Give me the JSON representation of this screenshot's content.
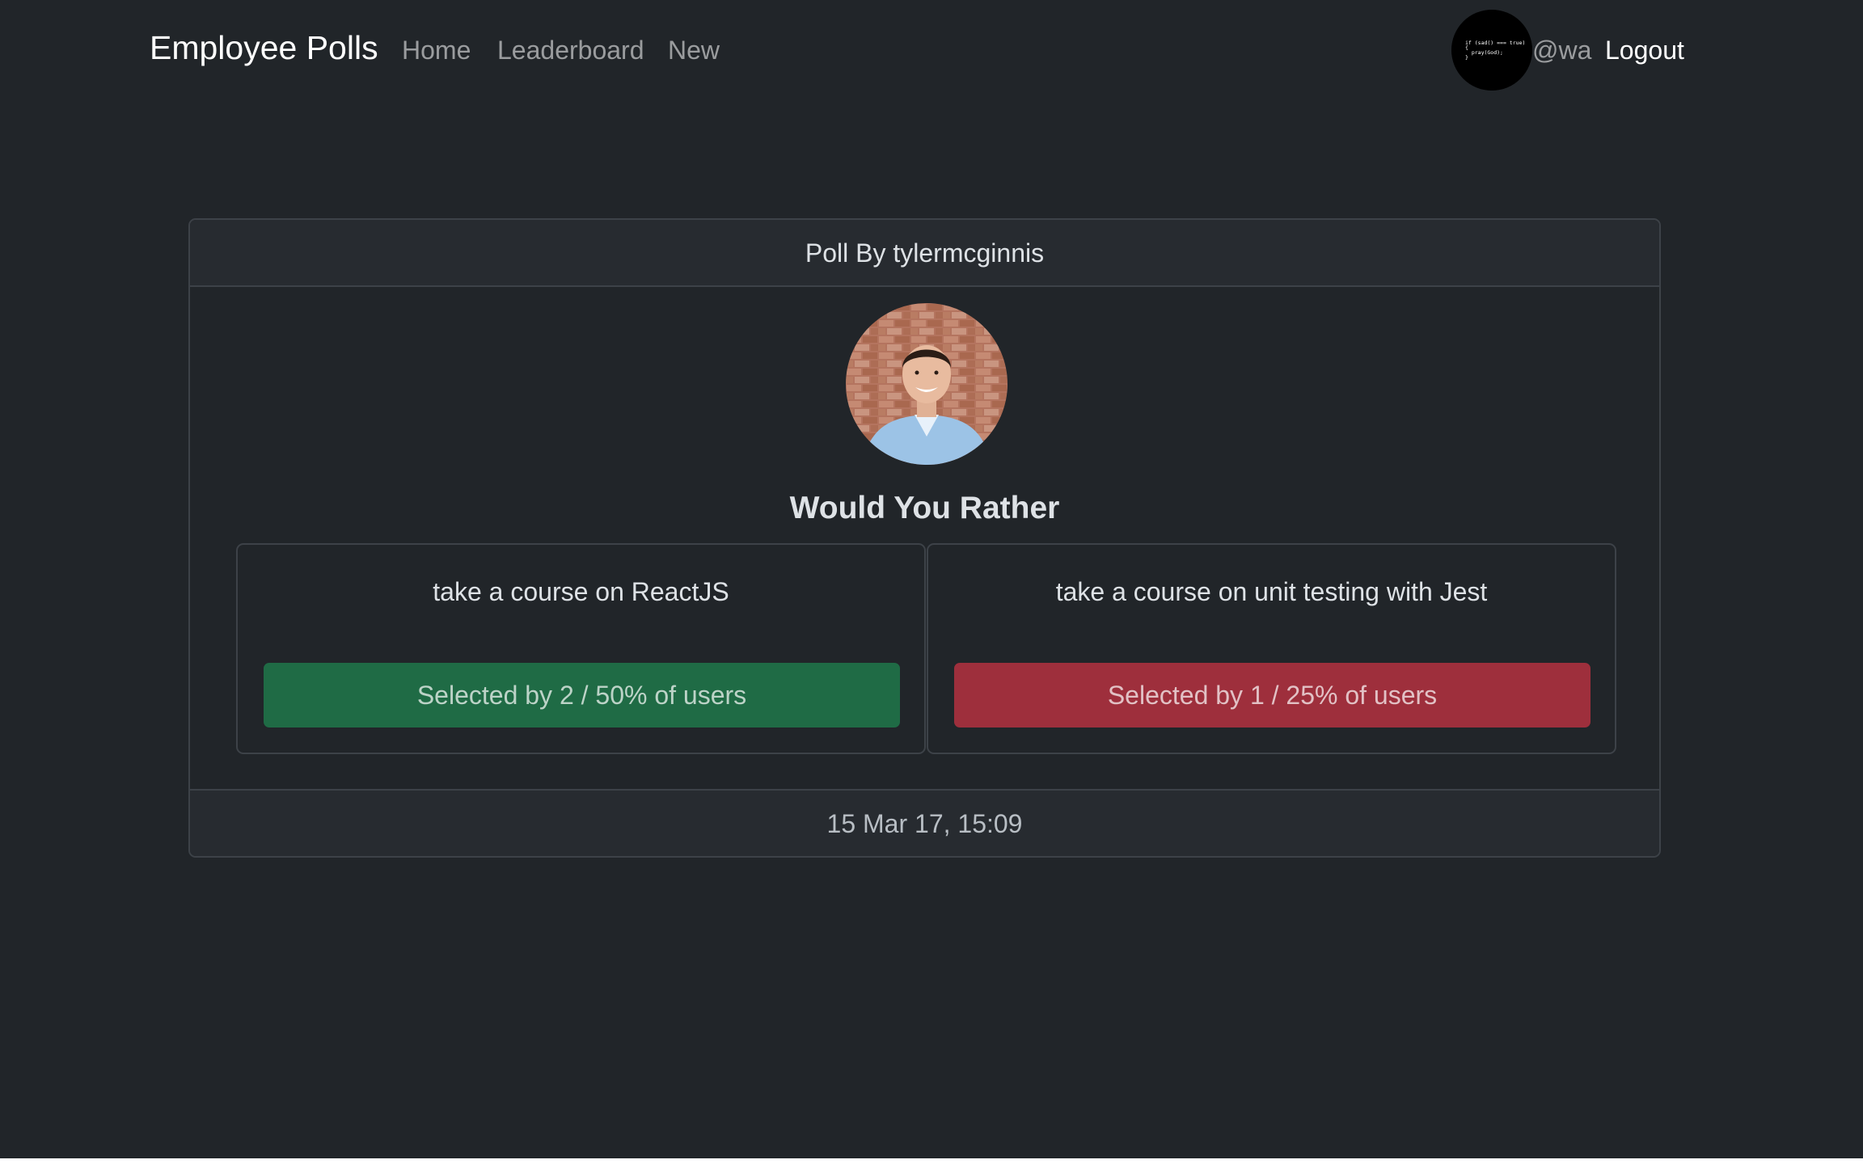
{
  "nav": {
    "brand": "Employee Polls",
    "links": [
      "Home",
      "Leaderboard",
      "New"
    ],
    "user_handle": "@wa",
    "logout_label": "Logout",
    "user_avatar_icon": "code-snippet-avatar",
    "user_avatar_code": [
      "if (sad() === true)",
      "{",
      "  pray(God);",
      "}"
    ]
  },
  "poll": {
    "header": "Poll By tylermcginnis",
    "author_avatar_icon": "person-photo-avatar",
    "question": "Would You Rather",
    "options": [
      {
        "text": "take a course on ReactJS",
        "result": "Selected by 2 / 50% of users",
        "votes": 2,
        "percent": 50,
        "color": "#1f6b45"
      },
      {
        "text": "take a course on unit testing with Jest",
        "result": "Selected by 1 / 25% of users",
        "votes": 1,
        "percent": 25,
        "color": "#9e2f3c"
      }
    ],
    "timestamp": "15 Mar 17, 15:09"
  },
  "colors": {
    "background": "#212529",
    "card_border": "#3d4248",
    "header_bg": "#272b30"
  }
}
